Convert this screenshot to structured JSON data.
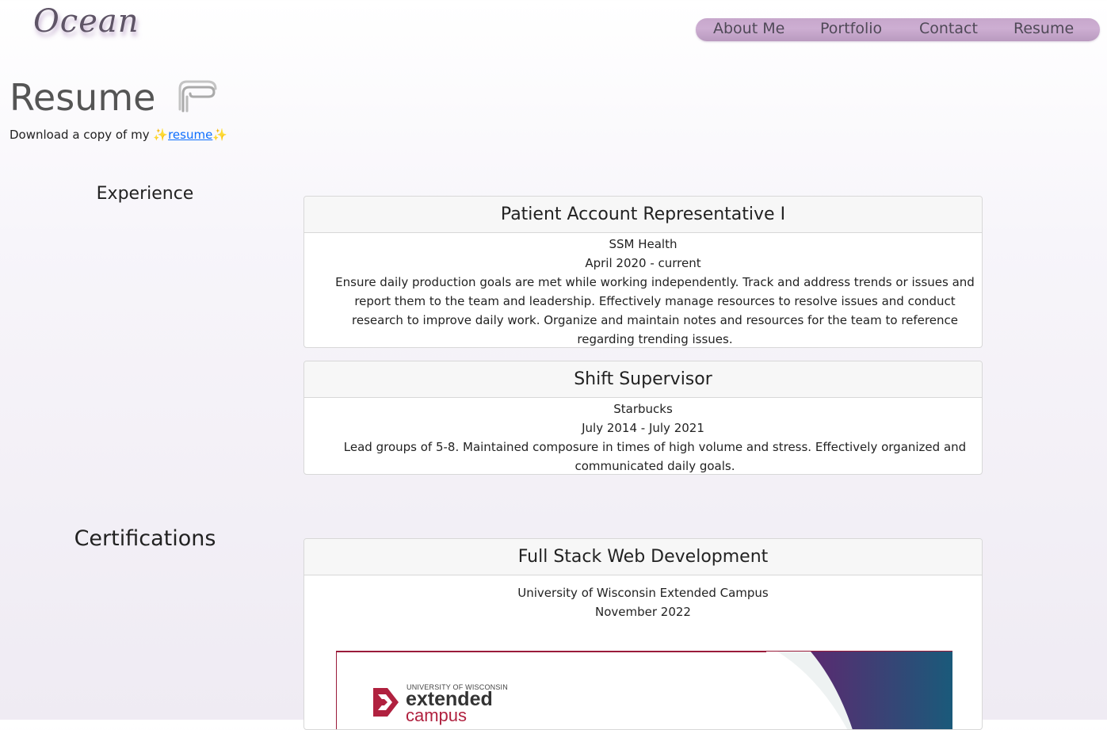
{
  "brand": {
    "logo_text": "Ocean"
  },
  "nav": {
    "items": [
      "About Me",
      "Portfolio",
      "Contact",
      "Resume"
    ]
  },
  "header": {
    "title": "Resume",
    "download_prefix": "Download a copy of my",
    "sparkle": "✨",
    "download_link": "resume"
  },
  "experience": {
    "heading": "Experience",
    "jobs": [
      {
        "title": "Patient Account Representative I",
        "company": "SSM Health",
        "dates": "April 2020 - current",
        "description": "Ensure daily production goals are met while working independently. Track and address trends or issues and report them to the team and leadership. Effectively manage resources to resolve issues and conduct research to improve daily work. Organize and maintain notes and resources for the team to reference regarding trending issues."
      },
      {
        "title": "Shift Supervisor",
        "company": "Starbucks",
        "dates": "July 2014 - July 2021",
        "description": "Lead groups of 5-8. Maintained composure in times of high volume and stress. Effectively organized and communicated daily goals."
      }
    ]
  },
  "certifications": {
    "heading": "Certifications",
    "items": [
      {
        "title": "Full Stack Web Development",
        "issuer": "University of Wisconsin Extended Campus",
        "date": "November 2022",
        "image_text": {
          "institution": "UNIVERSITY OF WISCONSIN",
          "line1": "extended",
          "line2": "campus"
        }
      }
    ]
  },
  "colors": {
    "nav_bg": "#c7a7cc",
    "brand_red": "#b0213f",
    "brand_dark": "#333333",
    "gradient_purple": "#5a2a70",
    "gradient_blue": "#1a5a7a"
  }
}
